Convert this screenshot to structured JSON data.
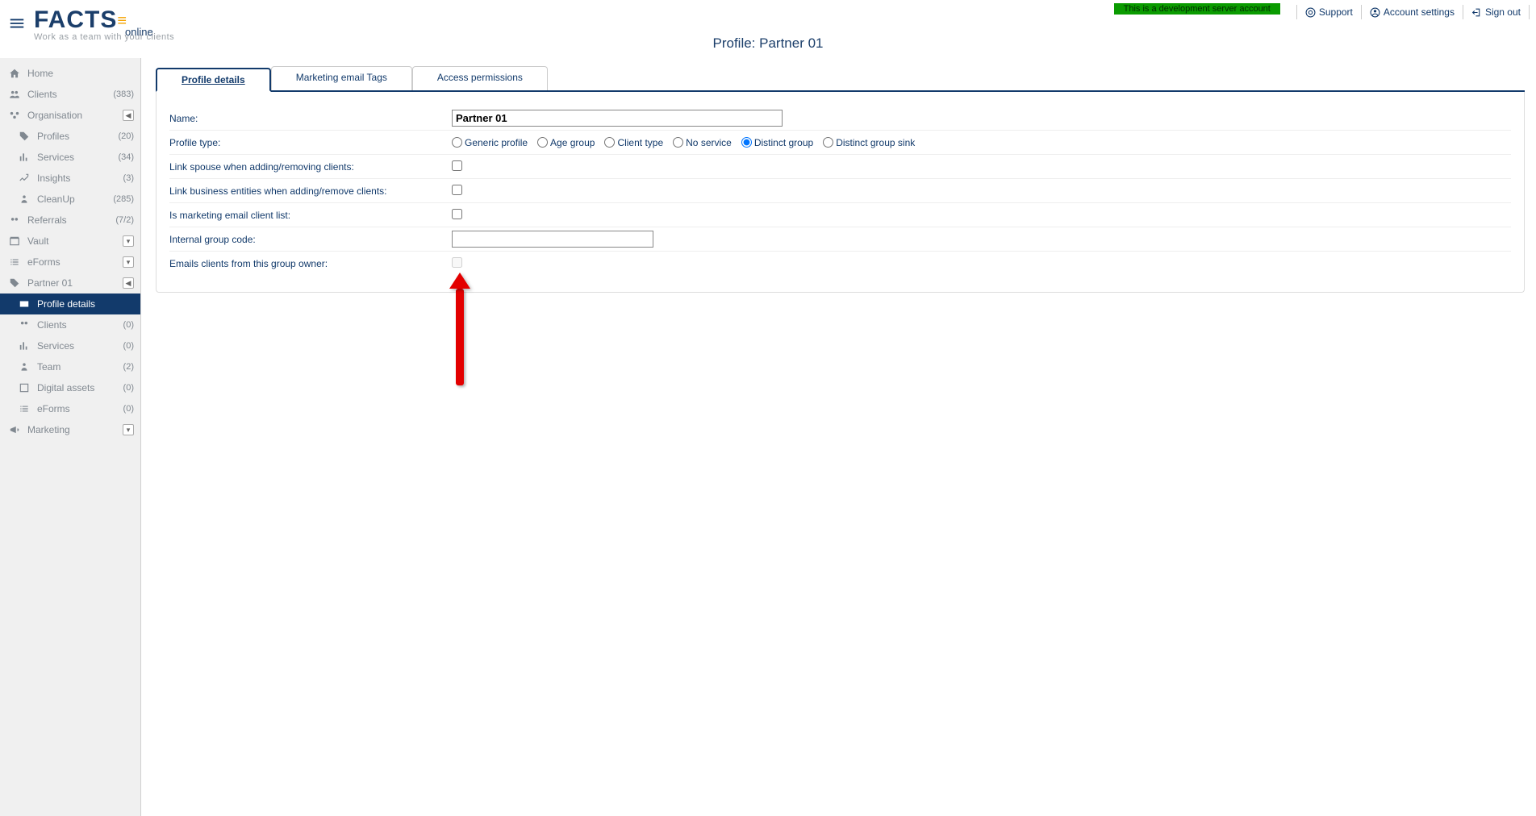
{
  "header": {
    "logo_main": "FACTS",
    "logo_suffix": "online",
    "tagline": "Work as a team with your clients",
    "dev_banner": "This is a development server account",
    "links": {
      "support": "Support",
      "account": "Account settings",
      "signout": "Sign out"
    }
  },
  "page_title": "Profile: Partner 01",
  "sidebar": {
    "home": "Home",
    "clients": {
      "label": "Clients",
      "count": "(383)"
    },
    "organisation": {
      "label": "Organisation"
    },
    "profiles": {
      "label": "Profiles",
      "count": "(20)"
    },
    "services": {
      "label": "Services",
      "count": "(34)"
    },
    "insights": {
      "label": "Insights",
      "count": "(3)"
    },
    "cleanup": {
      "label": "CleanUp",
      "count": "(285)"
    },
    "referrals": {
      "label": "Referrals",
      "count": "(7/2)"
    },
    "vault": {
      "label": "Vault"
    },
    "eforms": {
      "label": "eForms"
    },
    "partner01": {
      "label": "Partner 01"
    },
    "profile_details": {
      "label": "Profile details"
    },
    "sub_clients": {
      "label": "Clients",
      "count": "(0)"
    },
    "sub_services": {
      "label": "Services",
      "count": "(0)"
    },
    "team": {
      "label": "Team",
      "count": "(2)"
    },
    "digital_assets": {
      "label": "Digital assets",
      "count": "(0)"
    },
    "sub_eforms": {
      "label": "eForms",
      "count": "(0)"
    },
    "marketing": {
      "label": "Marketing"
    }
  },
  "tabs": {
    "profile_details": "Profile details",
    "marketing_tags": "Marketing email Tags",
    "access_permissions": "Access permissions"
  },
  "form": {
    "name_label": "Name:",
    "name_value": "Partner 01",
    "profile_type_label": "Profile type:",
    "radio_generic": "Generic profile",
    "radio_age": "Age group",
    "radio_client_type": "Client type",
    "radio_no_service": "No service",
    "radio_distinct_group": "Distinct group",
    "radio_distinct_sink": "Distinct group sink",
    "link_spouse_label": "Link spouse when adding/removing clients:",
    "link_business_label": "Link business entities when adding/remove clients:",
    "is_marketing_label": "Is marketing email client list:",
    "internal_code_label": "Internal group code:",
    "internal_code_value": "",
    "emails_owner_label": "Emails clients from this group owner:"
  }
}
